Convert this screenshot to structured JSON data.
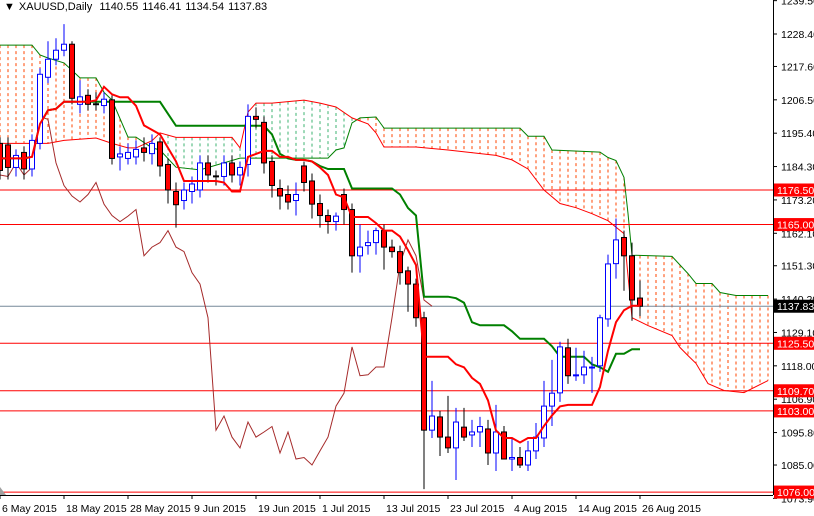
{
  "header": {
    "menu_icon": "triangle-down-icon",
    "symbol": "XAUUSD,Daily",
    "open": "1140.55",
    "high": "1146.41",
    "low": "1134.54",
    "close": "1137.83"
  },
  "colors": {
    "bull": "#0000ff",
    "bear": "#ff0000",
    "tenkan": "#ff0000",
    "kijun": "#008000",
    "chikou": "#a52a2a",
    "span_a": "#008000",
    "span_b": "#ff0000",
    "cloud_bear": "#ff4500",
    "cloud_bull": "#3cb371",
    "level": "#ff0000",
    "price_line": "#778899"
  },
  "chart_data": {
    "type": "candlestick",
    "title": "XAUUSD,Daily",
    "ylim": [
      1073.9,
      1239.5
    ],
    "y_ticks": [
      "1239.50",
      "1228.40",
      "1217.60",
      "1206.50",
      "1195.40",
      "1184.30",
      "1173.20",
      "1162.10",
      "1151.30",
      "1140.20",
      "1129.10",
      "1118.00",
      "1106.90",
      "1095.80",
      "1085.00",
      "1073.90"
    ],
    "x_labels": [
      {
        "bar": 0,
        "label": "6 May 2015"
      },
      {
        "bar": 8,
        "label": "18 May 2015"
      },
      {
        "bar": 16,
        "label": "28 May 2015"
      },
      {
        "bar": 24,
        "label": "9 Jun 2015"
      },
      {
        "bar": 32,
        "label": "19 Jun 2015"
      },
      {
        "bar": 40,
        "label": "1 Jul 2015"
      },
      {
        "bar": 48,
        "label": "13 Jul 2015"
      },
      {
        "bar": 56,
        "label": "23 Jul 2015"
      },
      {
        "bar": 64,
        "label": "4 Aug 2015"
      },
      {
        "bar": 72,
        "label": "14 Aug 2015"
      },
      {
        "bar": 80,
        "label": "26 Aug 2015"
      }
    ],
    "ohlc": [
      [
        1192,
        1194,
        1180,
        1183
      ],
      [
        1191.5,
        1194,
        1180,
        1184
      ],
      [
        1184,
        1190,
        1181,
        1188
      ],
      [
        1189,
        1191,
        1180,
        1183.5
      ],
      [
        1183.5,
        1195,
        1181,
        1193
      ],
      [
        1192,
        1217,
        1190,
        1215
      ],
      [
        1214,
        1226,
        1212,
        1220
      ],
      [
        1220,
        1227,
        1218,
        1223
      ],
      [
        1223,
        1231.7,
        1221,
        1225
      ],
      [
        1225,
        1226,
        1205,
        1207
      ],
      [
        1205,
        1213,
        1202,
        1207.5
      ],
      [
        1208,
        1210,
        1203,
        1205
      ],
      [
        1205.2,
        1209,
        1203,
        1205
      ],
      [
        1204.6,
        1209,
        1202,
        1206.7
      ],
      [
        1206.5,
        1208,
        1185,
        1187
      ],
      [
        1187.5,
        1191,
        1183,
        1188.5
      ],
      [
        1187,
        1192,
        1185,
        1189
      ],
      [
        1187.5,
        1193,
        1185,
        1190
      ],
      [
        1190.5,
        1194,
        1186,
        1189
      ],
      [
        1188.6,
        1195,
        1185,
        1192
      ],
      [
        1192.5,
        1194,
        1181,
        1184.5
      ],
      [
        1185,
        1187,
        1172,
        1176.5
      ],
      [
        1176,
        1179,
        1164,
        1171.6
      ],
      [
        1173,
        1179,
        1170,
        1176.5
      ],
      [
        1176,
        1181,
        1172,
        1178.5
      ],
      [
        1176.5,
        1188,
        1174,
        1185.5
      ],
      [
        1185.5,
        1188,
        1179,
        1181.5
      ],
      [
        1181.2,
        1183,
        1178,
        1181
      ],
      [
        1181,
        1188,
        1178,
        1185.5
      ],
      [
        1185.5,
        1188,
        1179,
        1181.5
      ],
      [
        1181.5,
        1186,
        1178,
        1184
      ],
      [
        1185,
        1205,
        1181,
        1201
      ],
      [
        1201,
        1204,
        1197,
        1200
      ],
      [
        1199,
        1201,
        1182,
        1185.5
      ],
      [
        1186,
        1188,
        1174,
        1178
      ],
      [
        1177,
        1180,
        1170,
        1174.5
      ],
      [
        1175,
        1178,
        1170,
        1172.5
      ],
      [
        1173,
        1179,
        1168,
        1175
      ],
      [
        1184.5,
        1186,
        1176,
        1179
      ],
      [
        1179.5,
        1182,
        1167,
        1171.8
      ],
      [
        1172,
        1175,
        1164,
        1168
      ],
      [
        1168,
        1170,
        1162,
        1166
      ],
      [
        1166,
        1169,
        1163,
        1167.8
      ],
      [
        1175,
        1177,
        1165,
        1170
      ],
      [
        1170,
        1172,
        1149,
        1154.6
      ],
      [
        1154.6,
        1165,
        1149,
        1157.5
      ],
      [
        1158,
        1163,
        1155,
        1159
      ],
      [
        1159,
        1164,
        1155,
        1163
      ],
      [
        1163,
        1165,
        1150,
        1157.5
      ],
      [
        1157.5,
        1160,
        1154,
        1156
      ],
      [
        1156,
        1158,
        1145,
        1149
      ],
      [
        1149.6,
        1151,
        1136,
        1145.2
      ],
      [
        1145.2,
        1147,
        1131,
        1134
      ],
      [
        1134,
        1136,
        1077,
        1096.6
      ],
      [
        1096.6,
        1113,
        1094,
        1101.3
      ],
      [
        1101,
        1103,
        1088,
        1094.3
      ],
      [
        1094.3,
        1108,
        1089,
        1090.7
      ],
      [
        1090.7,
        1104,
        1080,
        1099.3
      ],
      [
        1097.6,
        1104,
        1093,
        1094.3
      ],
      [
        1095,
        1100,
        1091,
        1096
      ],
      [
        1096,
        1101,
        1091,
        1097.8
      ],
      [
        1097,
        1100,
        1085,
        1089
      ],
      [
        1089,
        1105,
        1083,
        1096
      ],
      [
        1096,
        1098,
        1088,
        1087
      ],
      [
        1087,
        1094,
        1083,
        1087.5
      ],
      [
        1087.5,
        1091,
        1084,
        1085
      ],
      [
        1085,
        1093,
        1083,
        1089.7
      ],
      [
        1089.7,
        1099,
        1087,
        1094.3
      ],
      [
        1094,
        1113,
        1091,
        1104.6
      ],
      [
        1104.6,
        1120,
        1098,
        1108.9
      ],
      [
        1109,
        1126,
        1106,
        1124.3
      ],
      [
        1124,
        1127,
        1112,
        1114.7
      ],
      [
        1114.7,
        1124,
        1113,
        1115
      ],
      [
        1115,
        1123,
        1112,
        1117.6
      ],
      [
        1117.6,
        1121,
        1109,
        1117.6
      ],
      [
        1118,
        1135,
        1116,
        1134
      ],
      [
        1133.6,
        1155,
        1131,
        1151.9
      ],
      [
        1152,
        1167,
        1147,
        1159.9
      ],
      [
        1160.7,
        1163,
        1143,
        1154.6
      ],
      [
        1154.6,
        1159,
        1133,
        1139.9
      ],
      [
        1140.55,
        1146.41,
        1134.54,
        1137.83
      ]
    ],
    "indicator": {
      "name": "Ichimoku",
      "tenkan_period": 9,
      "kijun_period": 26,
      "chikou_shift": 26,
      "span_a": [
        [
          0,
          1224.7
        ],
        [
          4,
          1224.7
        ],
        [
          5,
          1221.4
        ],
        [
          6,
          1220.4
        ],
        [
          8,
          1218.8
        ],
        [
          10,
          1213.8
        ],
        [
          12,
          1213.8
        ],
        [
          13,
          1209
        ],
        [
          14,
          1206.4
        ],
        [
          16,
          1194.1
        ],
        [
          17,
          1194.1
        ],
        [
          19,
          1190.5
        ],
        [
          20,
          1189.8
        ],
        [
          22,
          1184.1
        ],
        [
          25,
          1183.2
        ],
        [
          30,
          1187.1
        ],
        [
          41,
          1187.1
        ],
        [
          42,
          1189.8
        ],
        [
          43,
          1190.5
        ],
        [
          44,
          1198.8
        ],
        [
          45,
          1200.5
        ],
        [
          47,
          1200.8
        ],
        [
          48,
          1197.1
        ],
        [
          65,
          1197.1
        ],
        [
          66,
          1194.4
        ],
        [
          68,
          1194.4
        ],
        [
          69,
          1189.8
        ],
        [
          75,
          1189.1
        ],
        [
          76,
          1187.3
        ],
        [
          77,
          1186.3
        ],
        [
          78,
          1180.7
        ],
        [
          78.5,
          1168.7
        ],
        [
          79,
          1154.8
        ],
        [
          84,
          1154.4
        ],
        [
          86,
          1148.7
        ],
        [
          87,
          1145.4
        ],
        [
          89,
          1145.4
        ],
        [
          90,
          1142.4
        ],
        [
          92,
          1141.4
        ],
        [
          96,
          1141.4
        ]
      ],
      "span_b": [
        [
          0,
          1192
        ],
        [
          6,
          1192
        ],
        [
          8,
          1193
        ],
        [
          12,
          1193.8
        ],
        [
          14,
          1192
        ],
        [
          16,
          1190.5
        ],
        [
          17,
          1190.5
        ],
        [
          19,
          1192.9
        ],
        [
          20,
          1195.5
        ],
        [
          22,
          1194
        ],
        [
          29,
          1194
        ],
        [
          30,
          1190.5
        ],
        [
          31,
          1202.4
        ],
        [
          32,
          1205.4
        ],
        [
          34,
          1205.4
        ],
        [
          38,
          1206.4
        ],
        [
          40,
          1205.4
        ],
        [
          42,
          1204.1
        ],
        [
          44,
          1200.5
        ],
        [
          46,
          1198.5
        ],
        [
          47,
          1195.5
        ],
        [
          48,
          1190.8
        ],
        [
          52,
          1190.8
        ],
        [
          56,
          1189.8
        ],
        [
          62,
          1188
        ],
        [
          64,
          1186.5
        ],
        [
          66,
          1183.5
        ],
        [
          68,
          1176.5
        ],
        [
          70,
          1172
        ],
        [
          72,
          1170.6
        ],
        [
          74,
          1168.6
        ],
        [
          76,
          1166.3
        ],
        [
          78,
          1162
        ],
        [
          79,
          1134
        ],
        [
          81,
          1131.4
        ],
        [
          84,
          1128.1
        ],
        [
          85,
          1124.1
        ],
        [
          86,
          1121.4
        ],
        [
          87,
          1118.8
        ],
        [
          88.5,
          1112.1
        ],
        [
          90.5,
          1109.8
        ],
        [
          93,
          1109.1
        ],
        [
          96,
          1113.1
        ]
      ]
    },
    "levels": [
      "1176.50",
      "1165.00",
      "1125.50",
      "1109.70",
      "1103.00",
      "1076.00"
    ],
    "current_price": "1137.83"
  }
}
